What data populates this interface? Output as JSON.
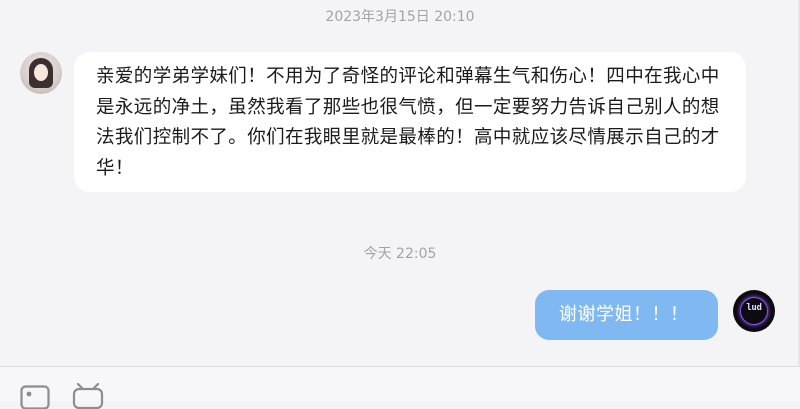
{
  "chat": {
    "messages": [
      {
        "timestamp": "2023年3月15日 20:10",
        "sender": "other",
        "text": "亲爱的学弟学妹们！不用为了奇怪的评论和弹幕生气和伤心！四中在我心中是永远的净土，虽然我看了那些也很气愤，但一定要努力告诉自己别人的想法我们控制不了。你们在我眼里就是最棒的！高中就应该尽情展示自己的才华！"
      },
      {
        "timestamp": "今天 22:05",
        "sender": "self",
        "text": "谢谢学姐！！！",
        "avatar_text": "lud"
      }
    ]
  },
  "colors": {
    "background": "#f4f4f6",
    "incoming_bubble": "#ffffff",
    "outgoing_bubble": "#80b9f2",
    "timestamp_text": "#a3a3a8"
  },
  "input_bar": {
    "icons": [
      "image-icon",
      "sticker-icon"
    ]
  }
}
